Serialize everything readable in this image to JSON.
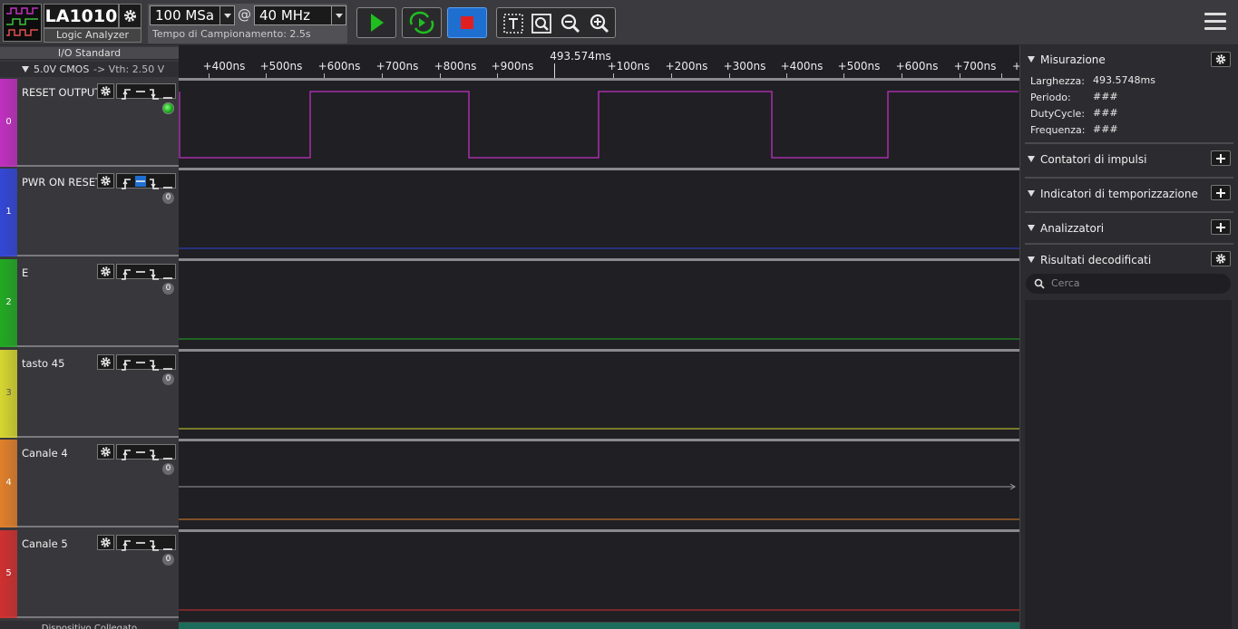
{
  "device": {
    "name": "LA1010",
    "subtitle": "Logic Analyzer"
  },
  "sampling": {
    "rate": "100 MSa",
    "at": "@",
    "frequency": "40 MHz",
    "tempo": "Tempo di Campionamento: 2.5s"
  },
  "colors": {
    "start": "#1fbf1f",
    "stop": "#e02020",
    "stop_bg": "#1e6fd0"
  },
  "io": {
    "standard_label": "I/O Standard",
    "voltage": "5.0V CMOS",
    "vth": "-> Vth: 2.50 V"
  },
  "channels": [
    {
      "index": "0",
      "name": "RESET OUTPUT",
      "color": "#c030c0",
      "counter": "",
      "active": true
    },
    {
      "index": "1",
      "name": "PWR ON RESET",
      "color": "#3346d6",
      "counter": "0",
      "active": false
    },
    {
      "index": "2",
      "name": "E",
      "color": "#22aa22",
      "counter": "0",
      "active": false
    },
    {
      "index": "3",
      "name": "tasto 45",
      "color": "#d6d630",
      "counter": "0",
      "active": false
    },
    {
      "index": "4",
      "name": "Canale 4",
      "color": "#e0802a",
      "counter": "0",
      "active": false
    },
    {
      "index": "5",
      "name": "Canale 5",
      "color": "#d03030",
      "counter": "0",
      "active": false
    }
  ],
  "sidebar_bottom": "Dispositivo Collegato",
  "ruler": {
    "center": "493.574ms",
    "ticks": [
      "+400ns",
      "+500ns",
      "+600ns",
      "+700ns",
      "+800ns",
      "+900ns",
      "+100ns",
      "+200ns",
      "+300ns",
      "+400ns",
      "+500ns",
      "+600ns",
      "+700ns",
      "+"
    ]
  },
  "panel": {
    "misurazione": "Misurazione",
    "larghezza_label": "Larghezza:",
    "larghezza_value": "493.5748ms",
    "periodo_label": "Periodo:",
    "periodo_value": "###",
    "duty_label": "DutyCycle:",
    "duty_value": "###",
    "freq_label": "Frequenza:",
    "freq_value": "###",
    "contatori": "Contatori di impulsi",
    "indicatori": "Indicatori di temporizzazione",
    "analizzatori": "Analizzatori",
    "risultati": "Risultati decodificati",
    "search_placeholder": "Cerca"
  }
}
